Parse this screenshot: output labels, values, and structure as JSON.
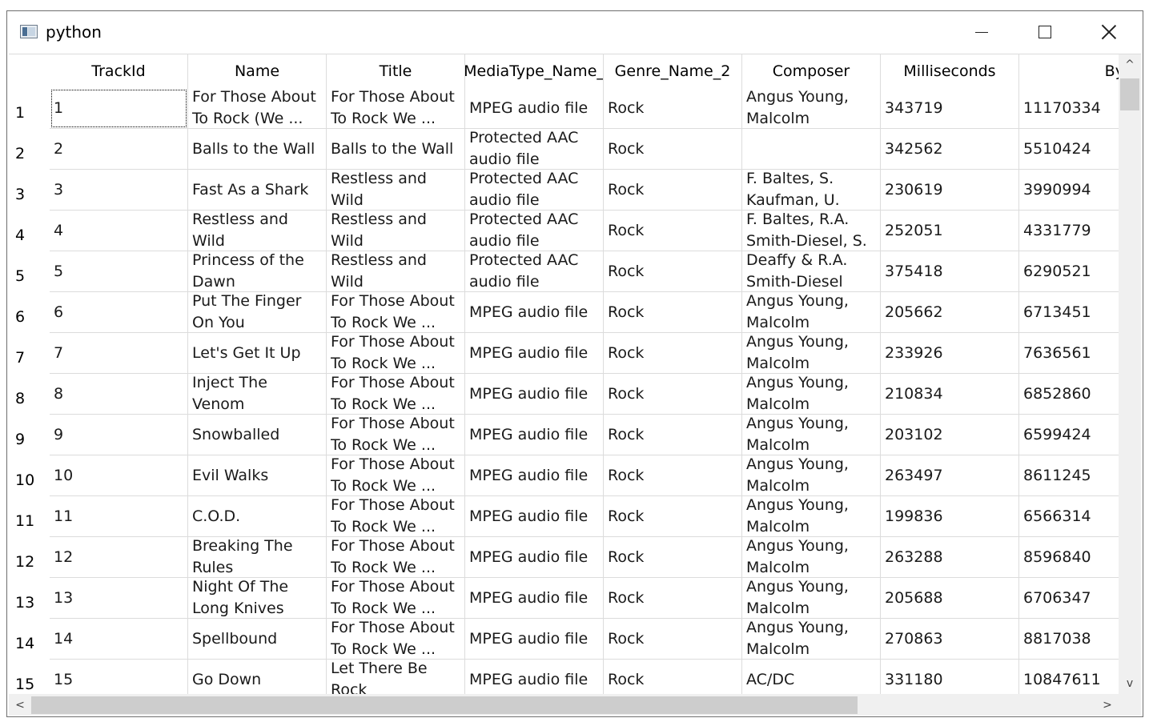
{
  "window": {
    "title": "python",
    "icon": "python-window-icon"
  },
  "controls": {
    "minimize_icon": "minimize-icon",
    "maximize_icon": "maximize-icon",
    "close_icon": "close-icon"
  },
  "table": {
    "columns": [
      "TrackId",
      "Name",
      "Title",
      "MediaType_Name_",
      "Genre_Name_2",
      "Composer",
      "Milliseconds",
      "Bytes"
    ],
    "row_headers": [
      "1",
      "2",
      "3",
      "4",
      "5",
      "6",
      "7",
      "8",
      "9",
      "10",
      "11",
      "12",
      "13",
      "14",
      "15"
    ],
    "rows": [
      [
        "1",
        "For Those About To Rock (We ...",
        "For Those About To Rock We ...",
        "MPEG audio file",
        "Rock",
        "Angus Young, Malcolm Young,...",
        "343719",
        "11170334"
      ],
      [
        "2",
        "Balls to the Wall",
        "Balls to the Wall",
        "Protected AAC audio file",
        "Rock",
        "",
        "342562",
        "5510424"
      ],
      [
        "3",
        "Fast As a Shark",
        "Restless and Wild",
        "Protected AAC audio file",
        "Rock",
        "F. Baltes, S. Kaufman, U. Dirkscneider & ...",
        "230619",
        "3990994"
      ],
      [
        "4",
        "Restless and Wild",
        "Restless and Wild",
        "Protected AAC audio file",
        "Rock",
        "F. Baltes, R.A. Smith-Diesel, S. Kaufman, U. ...",
        "252051",
        "4331779"
      ],
      [
        "5",
        "Princess of the Dawn",
        "Restless and Wild",
        "Protected AAC audio file",
        "Rock",
        "Deaffy & R.A. Smith-Diesel",
        "375418",
        "6290521"
      ],
      [
        "6",
        "Put The Finger On You",
        "For Those About To Rock We ...",
        "MPEG audio file",
        "Rock",
        "Angus Young, Malcolm Young,...",
        "205662",
        "6713451"
      ],
      [
        "7",
        "Let's Get It Up",
        "For Those About To Rock We ...",
        "MPEG audio file",
        "Rock",
        "Angus Young, Malcolm Young,...",
        "233926",
        "7636561"
      ],
      [
        "8",
        "Inject The Venom",
        "For Those About To Rock We ...",
        "MPEG audio file",
        "Rock",
        "Angus Young, Malcolm Young,...",
        "210834",
        "6852860"
      ],
      [
        "9",
        "Snowballed",
        "For Those About To Rock We ...",
        "MPEG audio file",
        "Rock",
        "Angus Young, Malcolm Young,...",
        "203102",
        "6599424"
      ],
      [
        "10",
        "Evil Walks",
        "For Those About To Rock We ...",
        "MPEG audio file",
        "Rock",
        "Angus Young, Malcolm Young,...",
        "263497",
        "8611245"
      ],
      [
        "11",
        "C.O.D.",
        "For Those About To Rock We ...",
        "MPEG audio file",
        "Rock",
        "Angus Young, Malcolm Young,...",
        "199836",
        "6566314"
      ],
      [
        "12",
        "Breaking The Rules",
        "For Those About To Rock We ...",
        "MPEG audio file",
        "Rock",
        "Angus Young, Malcolm Young,...",
        "263288",
        "8596840"
      ],
      [
        "13",
        "Night Of The Long Knives",
        "For Those About To Rock We ...",
        "MPEG audio file",
        "Rock",
        "Angus Young, Malcolm Young,...",
        "205688",
        "6706347"
      ],
      [
        "14",
        "Spellbound",
        "For Those About To Rock We ...",
        "MPEG audio file",
        "Rock",
        "Angus Young, Malcolm Young,...",
        "270863",
        "8817038"
      ],
      [
        "15",
        "Go Down",
        "Let There Be Rock",
        "MPEG audio file",
        "Rock",
        "AC/DC",
        "331180",
        "10847611"
      ]
    ]
  },
  "scrollbars": {
    "up_arrow": "^",
    "down_arrow": "v",
    "left_arrow": "<",
    "right_arrow": ">"
  }
}
